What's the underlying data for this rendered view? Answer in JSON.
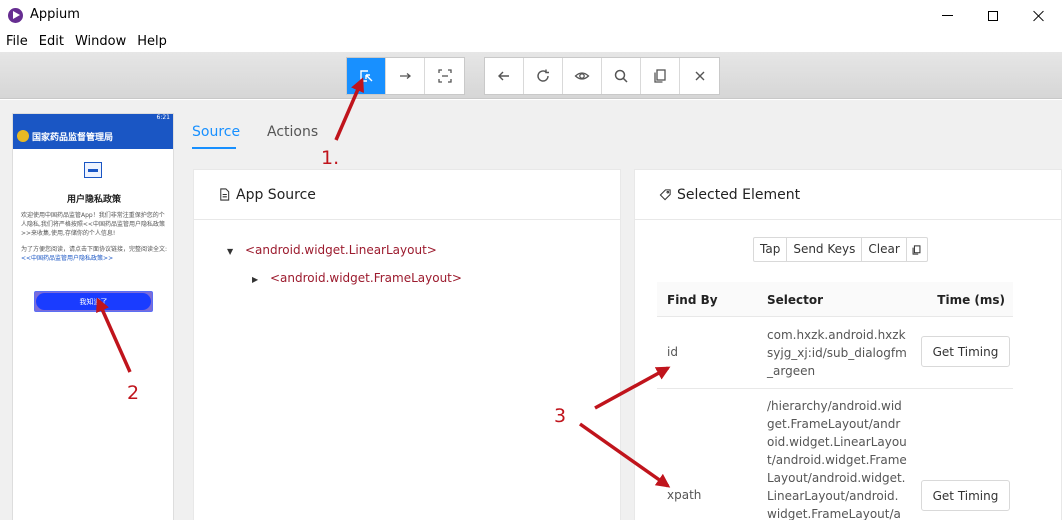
{
  "window": {
    "title": "Appium"
  },
  "menu": [
    "File",
    "Edit",
    "Window",
    "Help"
  ],
  "toolbar": {
    "group1": [
      "select-elements-icon",
      "swipe-icon",
      "tap-coordinates-icon"
    ],
    "group2": [
      "back-icon",
      "refresh-icon",
      "eye-icon",
      "search-icon",
      "copy-icon",
      "close-icon"
    ],
    "active": "select-elements-icon",
    "accent": "#1890ff"
  },
  "device": {
    "status_time": "6:21",
    "header_title": "国家药品监督管理局",
    "dialog_title": "用户隐私政策",
    "body_para1": "欢迎使用中国药品监管App！我们非常注重保护您的个人隐私,我们将严格按照<<中国药品监管用户隐私政策>>来收集,使用,存储你的个人信息!",
    "body_para2_prefix": "为了方便您阅读，请点击下面协议链接，完整阅读全文:",
    "body_para2_link": "<<中国药品监管用户隐私政策>>",
    "button_label": "我知道了"
  },
  "tabs": {
    "source": "Source",
    "actions": "Actions",
    "active": "Source"
  },
  "source": {
    "title": "App Source",
    "tree": [
      {
        "label": "<android.widget.LinearLayout>",
        "expanded": true
      },
      {
        "label": "<android.widget.FrameLayout>",
        "expanded": false
      }
    ]
  },
  "selected": {
    "title": "Selected Element",
    "actions": [
      "Tap",
      "Send Keys",
      "Clear"
    ],
    "columns": {
      "find_by": "Find By",
      "selector": "Selector",
      "time": "Time (ms)"
    },
    "rows": [
      {
        "find_by": "id",
        "selector": "com.hxzk.android.hxzksyjg_xj:id/sub_dialogfm_argeen",
        "button": "Get Timing"
      },
      {
        "find_by": "xpath",
        "selector": "/hierarchy/android.widget.FrameLayout/android.widget.LinearLayout/android.widget.FrameLayout/android.widget.LinearLayout/android.widget.FrameLayout/android.widget.Line",
        "button": "Get Timing"
      }
    ]
  },
  "annotations": {
    "one": "1.",
    "two": "2",
    "three": "3",
    "color": "#c0141c"
  }
}
